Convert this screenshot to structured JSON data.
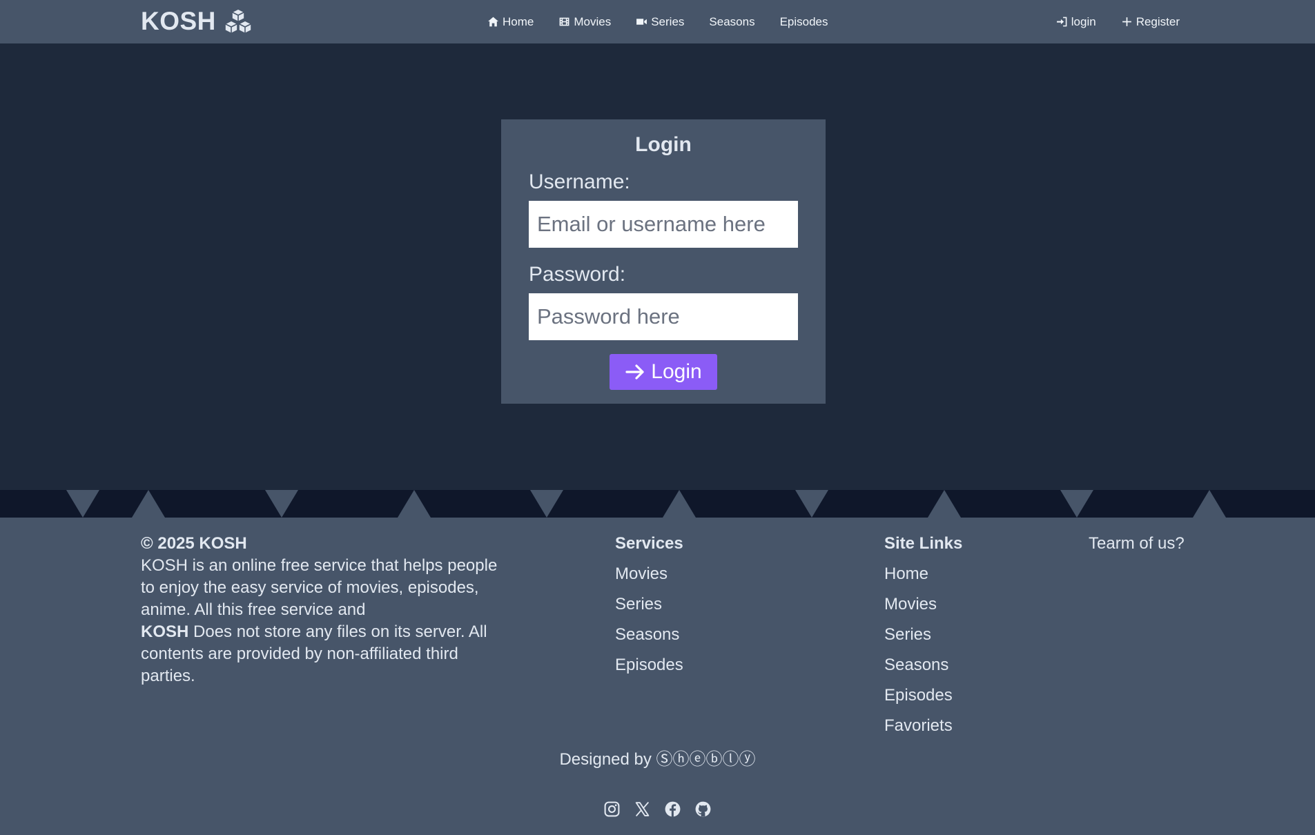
{
  "brand": {
    "name": "KOSH",
    "icon": "cubes-icon"
  },
  "nav": {
    "items": [
      {
        "label": "Home",
        "icon": "home-icon"
      },
      {
        "label": "Movies",
        "icon": "film-icon"
      },
      {
        "label": "Series",
        "icon": "video-camera-icon"
      },
      {
        "label": "Seasons",
        "icon": ""
      },
      {
        "label": "Episodes",
        "icon": ""
      }
    ],
    "right": [
      {
        "label": "login",
        "icon": "sign-in-icon"
      },
      {
        "label": "Register",
        "icon": "plus-icon"
      }
    ]
  },
  "login": {
    "title": "Login",
    "username_label": "Username:",
    "username_placeholder": "Email or username here",
    "username_value": "",
    "password_label": "Password:",
    "password_placeholder": "Password here",
    "password_value": "",
    "button_label": "Login",
    "button_icon": "arrow-right-icon"
  },
  "footer": {
    "copyright": "© 2025 KOSH",
    "about_part1": "KOSH is an online free service that helps people to enjoy the easy service of movies, episodes, anime. All this free service and",
    "about_brand": "KOSH",
    "about_part2": "Does not store any files on its server. All contents are provided by non-affiliated third parties.",
    "services": {
      "title": "Services",
      "links": [
        "Movies",
        "Series",
        "Seasons",
        "Episodes"
      ]
    },
    "site_links": {
      "title": "Site Links",
      "links": [
        "Home",
        "Movies",
        "Series",
        "Seasons",
        "Episodes",
        "Favoriets"
      ]
    },
    "team": {
      "title": "Tearm of us?"
    },
    "designed_by": "Designed by",
    "designer": "Ⓢⓗⓔⓑⓛⓨ",
    "socials": [
      "instagram-icon",
      "x-twitter-icon",
      "facebook-icon",
      "github-icon"
    ]
  },
  "colors": {
    "page_bg": "#1e293b",
    "panel_bg": "#475569",
    "strip_bg": "#0f172a",
    "accent": "#8b5cf6",
    "text": "#e2e8f0"
  }
}
